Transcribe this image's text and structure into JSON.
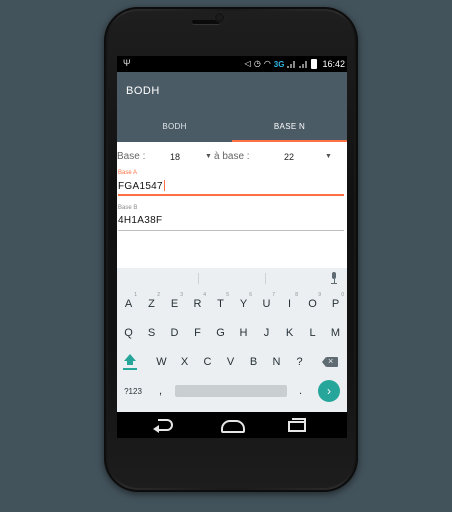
{
  "status": {
    "network": "3G",
    "time": "16:42"
  },
  "app": {
    "title": "BODH"
  },
  "tabs": [
    {
      "label": "BODH",
      "active": false
    },
    {
      "label": "BASE N",
      "active": true
    }
  ],
  "converter": {
    "base_label": "Base :",
    "base_value": "18",
    "to_base_label": "à base :",
    "to_base_value": "22"
  },
  "fields": {
    "a": {
      "label": "Base A",
      "value": "FGA1547"
    },
    "b": {
      "label": "Base B",
      "value": "4H1A38F"
    }
  },
  "keyboard": {
    "row1": [
      {
        "key": "A",
        "hint": "1"
      },
      {
        "key": "Z",
        "hint": "2"
      },
      {
        "key": "E",
        "hint": "3"
      },
      {
        "key": "R",
        "hint": "4"
      },
      {
        "key": "T",
        "hint": "5"
      },
      {
        "key": "Y",
        "hint": "6"
      },
      {
        "key": "U",
        "hint": "7"
      },
      {
        "key": "I",
        "hint": "8"
      },
      {
        "key": "O",
        "hint": "9"
      },
      {
        "key": "P",
        "hint": "0"
      }
    ],
    "row2": [
      "Q",
      "S",
      "D",
      "F",
      "G",
      "H",
      "J",
      "K",
      "L",
      "M"
    ],
    "row3": [
      "W",
      "X",
      "C",
      "V",
      "B",
      "N",
      "?"
    ],
    "symbols_label": "?123",
    "comma": ",",
    "period": ".",
    "enter_symbol": "›"
  },
  "colors": {
    "accent": "#ff7043",
    "primary": "#4a5b65",
    "keyboard_accent": "#26a69a",
    "background": "#43535c"
  },
  "icons": [
    "usb-icon",
    "mute-icon",
    "alarm-icon",
    "wifi-icon",
    "signal-icon",
    "battery-icon",
    "mic-icon",
    "shift-icon",
    "backspace-icon",
    "back-icon",
    "home-icon",
    "recents-icon"
  ]
}
